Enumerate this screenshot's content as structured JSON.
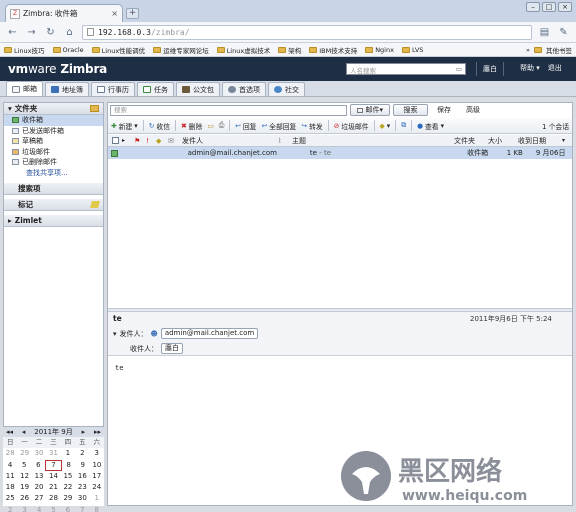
{
  "browser": {
    "tab_title": "Zimbra: 收件箱",
    "url_host": "192.168.0.3",
    "url_path": "/zimbra/",
    "bookmarks": [
      "Linux技巧",
      "Oracle",
      "Linux性能调优",
      "运维专家网论坛",
      "Linux虚拟技术",
      "架构",
      "IBM技术支持",
      "Nginx",
      "LVS"
    ],
    "other_bookmarks": "其他书签"
  },
  "header": {
    "logo_vm": "vm",
    "logo_ware": "ware",
    "logo_zimbra": " Zimbra",
    "people_search_placeholder": "人名搜索",
    "user": "廛白",
    "help": "帮助",
    "logout": "退出"
  },
  "app_tabs": [
    "邮箱",
    "地址簿",
    "行事历",
    "任务",
    "公文包",
    "首选项",
    "社交"
  ],
  "sidebar": {
    "folders_title": "文件夹",
    "folders": [
      "收件箱",
      "已发送邮件箱",
      "草稿箱",
      "垃圾邮件",
      "已删除邮件"
    ],
    "find_shares": "查找共享项...",
    "searches_title": "搜索项",
    "tags_title": "标记",
    "zimlet_title": "Zimlet"
  },
  "calendar": {
    "month_label": "2011年 9月",
    "dow": [
      "日",
      "一",
      "二",
      "三",
      "四",
      "五",
      "六"
    ],
    "weeks": [
      [
        "28",
        "29",
        "30",
        "31",
        "1",
        "2",
        "3"
      ],
      [
        "4",
        "5",
        "6",
        "7",
        "8",
        "9",
        "10"
      ],
      [
        "11",
        "12",
        "13",
        "14",
        "15",
        "16",
        "17"
      ],
      [
        "18",
        "19",
        "20",
        "21",
        "22",
        "23",
        "24"
      ],
      [
        "25",
        "26",
        "27",
        "28",
        "29",
        "30",
        "1"
      ],
      [
        "2",
        "3",
        "4",
        "5",
        "6",
        "7",
        "8"
      ]
    ],
    "today": "7"
  },
  "search": {
    "placeholder": "搜索",
    "type": "邮件",
    "search_btn": "搜索",
    "save_btn": "保存",
    "advanced_btn": "高级"
  },
  "toolbar": {
    "new": "新建",
    "get_mail": "收信",
    "delete": "删除",
    "reply": "回复",
    "reply_all": "全部回复",
    "forward": "转发",
    "spam": "垃圾邮件",
    "view": "查看",
    "count": "1 个会话"
  },
  "columns": {
    "sender": "发件人",
    "subject": "主题",
    "folder": "文件夹",
    "size": "大小",
    "received": "收到日期"
  },
  "message": {
    "sender": "admin@mail.chanjet.com",
    "subject": "te",
    "fragment": "- te",
    "folder": "收件箱",
    "size": "1 KB",
    "date": "9 月06日"
  },
  "reading": {
    "subject": "te",
    "date": "2011年9月6日 下午 5:24",
    "from_label": "发件人：",
    "from": "admin@mail.chanjet.com",
    "to_label": "收件人：",
    "to": "廛白",
    "body": "te"
  },
  "watermark": {
    "cn": "黑区网络",
    "url": "www.heiqu.com"
  },
  "colors": {
    "header_bg": "#1e2f45",
    "selection": "#c8d9ef",
    "link": "#214e9a",
    "watermark": "#8a8f99"
  }
}
